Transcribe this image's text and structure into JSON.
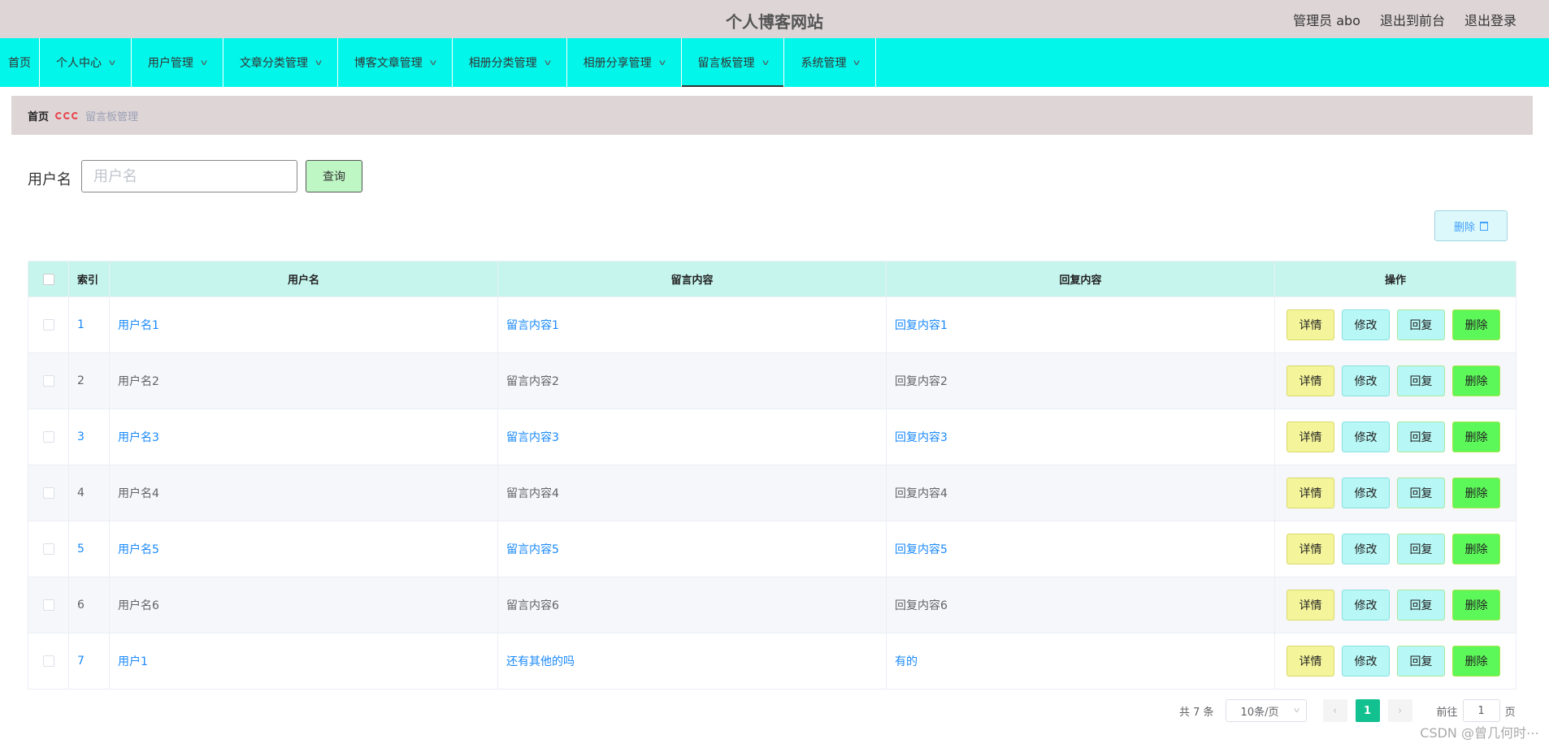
{
  "header": {
    "site_title": "个人博客网站",
    "admin_label": "管理员 abo",
    "to_front": "退出到前台",
    "logout": "退出登录"
  },
  "nav": {
    "items": [
      {
        "label": "首页",
        "dropdown": false
      },
      {
        "label": "个人中心",
        "dropdown": true
      },
      {
        "label": "用户管理",
        "dropdown": true
      },
      {
        "label": "文章分类管理",
        "dropdown": true
      },
      {
        "label": "博客文章管理",
        "dropdown": true
      },
      {
        "label": "相册分类管理",
        "dropdown": true
      },
      {
        "label": "相册分享管理",
        "dropdown": true
      },
      {
        "label": "留言板管理",
        "dropdown": true,
        "active": true
      },
      {
        "label": "系统管理",
        "dropdown": true
      }
    ],
    "chevron_icon": "chevron-down-icon"
  },
  "breadcrumb": {
    "home": "首页",
    "current": "留言板管理"
  },
  "search": {
    "label": "用户名",
    "placeholder": "用户名",
    "value": "",
    "button": "查询"
  },
  "toolbar": {
    "delete_label": "删除"
  },
  "table": {
    "headers": {
      "index": "索引",
      "username": "用户名",
      "message": "留言内容",
      "reply": "回复内容",
      "ops": "操作"
    },
    "rows": [
      {
        "index": "1",
        "username": "用户名1",
        "message": "留言内容1",
        "reply": "回复内容1"
      },
      {
        "index": "2",
        "username": "用户名2",
        "message": "留言内容2",
        "reply": "回复内容2"
      },
      {
        "index": "3",
        "username": "用户名3",
        "message": "留言内容3",
        "reply": "回复内容3"
      },
      {
        "index": "4",
        "username": "用户名4",
        "message": "留言内容4",
        "reply": "回复内容4"
      },
      {
        "index": "5",
        "username": "用户名5",
        "message": "留言内容5",
        "reply": "回复内容5"
      },
      {
        "index": "6",
        "username": "用户名6",
        "message": "留言内容6",
        "reply": "回复内容6"
      },
      {
        "index": "7",
        "username": "用户1",
        "message": "还有其他的吗",
        "reply": "有的"
      }
    ],
    "op_labels": {
      "detail": "详情",
      "edit": "修改",
      "reply": "回复",
      "delete": "删除"
    }
  },
  "pagination": {
    "total": "共 7 条",
    "page_size": "10条/页",
    "prev": "‹",
    "next": "›",
    "current_page": "1",
    "goto_label": "前往",
    "goto_value": "1",
    "page_suffix": "页"
  },
  "watermark": "CSDN @曾几何时⋯",
  "colors": {
    "nav_bg": "#03f6ea",
    "header_bg": "#ded5d7",
    "table_header_bg": "#c6f5ee",
    "link": "#1989fa",
    "page_active": "#13c08f"
  }
}
